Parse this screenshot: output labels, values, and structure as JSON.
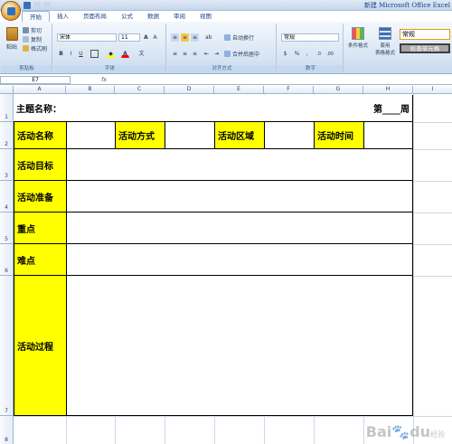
{
  "window": {
    "title": "新建 Microsoft Office Excel"
  },
  "tabs": [
    "开始",
    "插入",
    "页面布局",
    "公式",
    "数据",
    "审阅",
    "视图"
  ],
  "ribbon": {
    "clipboard": {
      "paste": "粘贴",
      "cut": "剪切",
      "copy": "复制",
      "format_painter": "格式刷",
      "label": "剪贴板"
    },
    "font": {
      "family": "宋体",
      "size": "11",
      "bold": "B",
      "italic": "I",
      "underline": "U",
      "font_color_glyph": "A",
      "label": "字体"
    },
    "alignment": {
      "wrap": "自动换行",
      "merge": "合并后居中",
      "label": "对齐方式"
    },
    "number": {
      "format": "常规",
      "percent": "%",
      "comma": ",",
      "label": "数字"
    },
    "styles": {
      "conditional": "条件格式",
      "table_format_line1": "套用",
      "table_format_line2": "表格格式",
      "cell_style_value": "常规",
      "check_cell": "检查单元格"
    }
  },
  "formula_bar": {
    "name_box": "E7",
    "fx": "fx"
  },
  "sheet": {
    "columns": [
      "A",
      "B",
      "C",
      "D",
      "E",
      "F",
      "G",
      "H",
      "I"
    ],
    "rows": [
      "1",
      "2",
      "3",
      "4",
      "5",
      "6",
      "7",
      "8"
    ],
    "cells": {
      "theme": "主题名称：",
      "week": "第____周",
      "activity_name": "活动名称",
      "activity_method": "活动方式",
      "activity_area": "活动区域",
      "activity_time": "活动时间",
      "activity_goal": "活动目标",
      "activity_prep": "活动准备",
      "key_point": "重点",
      "difficulty": "难点",
      "activity_process": "活动过程"
    }
  },
  "watermark": {
    "text": "Bai",
    "paw": "du",
    "suffix": "经验"
  },
  "colors": {
    "highlight": "#ffff00",
    "grid": "#d0d7e5",
    "header": "#e4ecf7"
  }
}
